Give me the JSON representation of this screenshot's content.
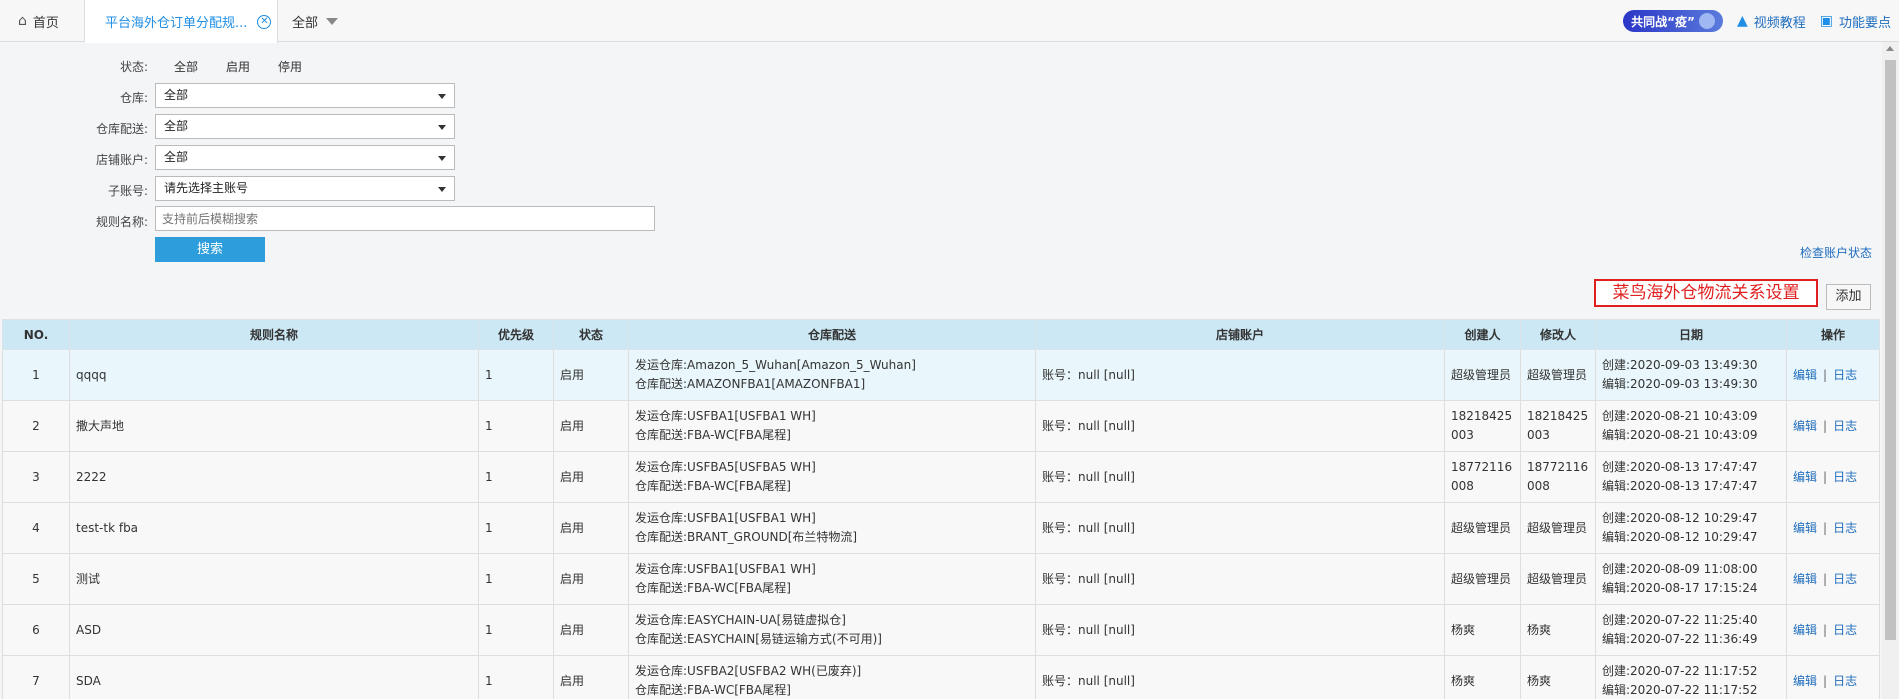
{
  "tabs": {
    "home": "首页",
    "active": "平台海外仓订单分配规...",
    "all": "全部"
  },
  "top_right": {
    "badge": "共同战“疫”",
    "video": "视频教程",
    "features": "功能要点"
  },
  "filters": {
    "status_label": "状态:",
    "status_options": [
      "全部",
      "启用",
      "停用"
    ],
    "warehouse_label": "仓库:",
    "warehouse_value": "全部",
    "delivery_label": "仓库配送:",
    "delivery_value": "全部",
    "shop_label": "店铺账户:",
    "shop_value": "全部",
    "sub_label": "子账号:",
    "sub_value": "请先选择主账号",
    "rule_label": "规则名称:",
    "rule_placeholder": "支持前后模糊搜索",
    "search_button": "搜索",
    "check_link": "检查账户状态"
  },
  "annotation": "菜鸟海外仓物流关系设置",
  "add_button": "添加",
  "table": {
    "headers": [
      "NO.",
      "规则名称",
      "优先级",
      "状态",
      "仓库配送",
      "店铺账户",
      "创建人",
      "修改人",
      "日期",
      "操作"
    ],
    "op_edit": "编辑",
    "op_sep": "|",
    "op_log": "日志",
    "rows": [
      {
        "no": "1",
        "name": "qqqq",
        "priority": "1",
        "status": "启用",
        "wh1": "发运仓库:Amazon_5_Wuhan[Amazon_5_Wuhan]",
        "wh2": "仓库配送:AMAZONFBA1[AMAZONFBA1]",
        "shop": "账号：null [null]",
        "creator": "超级管理员",
        "modifier": "超级管理员",
        "created": "创建:2020-09-03 13:49:30",
        "edited": "编辑:2020-09-03 13:49:30"
      },
      {
        "no": "2",
        "name": "撒大声地",
        "priority": "1",
        "status": "启用",
        "wh1": "发运仓库:USFBA1[USFBA1 WH]",
        "wh2": "仓库配送:FBA-WC[FBA尾程]",
        "shop": "账号：null [null]",
        "creator": "18218425003",
        "modifier": "18218425003",
        "created": "创建:2020-08-21 10:43:09",
        "edited": "编辑:2020-08-21 10:43:09"
      },
      {
        "no": "3",
        "name": "2222",
        "priority": "1",
        "status": "启用",
        "wh1": "发运仓库:USFBA5[USFBA5 WH]",
        "wh2": "仓库配送:FBA-WC[FBA尾程]",
        "shop": "账号：null [null]",
        "creator": "18772116008",
        "modifier": "18772116008",
        "created": "创建:2020-08-13 17:47:47",
        "edited": "编辑:2020-08-13 17:47:47"
      },
      {
        "no": "4",
        "name": "test-tk fba",
        "priority": "1",
        "status": "启用",
        "wh1": "发运仓库:USFBA1[USFBA1 WH]",
        "wh2": "仓库配送:BRANT_GROUND[布兰特物流]",
        "shop": "账号：null [null]",
        "creator": "超级管理员",
        "modifier": "超级管理员",
        "created": "创建:2020-08-12 10:29:47",
        "edited": "编辑:2020-08-12 10:29:47"
      },
      {
        "no": "5",
        "name": "测试",
        "priority": "1",
        "status": "启用",
        "wh1": "发运仓库:USFBA1[USFBA1 WH]",
        "wh2": "仓库配送:FBA-WC[FBA尾程]",
        "shop": "账号：null [null]",
        "creator": "超级管理员",
        "modifier": "超级管理员",
        "created": "创建:2020-08-09 11:08:00",
        "edited": "编辑:2020-08-17 17:15:24"
      },
      {
        "no": "6",
        "name": "ASD",
        "priority": "1",
        "status": "启用",
        "wh1": "发运仓库:EASYCHAIN-UA[易链虚拟仓]",
        "wh2": "仓库配送:EASYCHAIN[易链运输方式(不可用)]",
        "shop": "账号：null [null]",
        "creator": "杨爽",
        "modifier": "杨爽",
        "created": "创建:2020-07-22 11:25:40",
        "edited": "编辑:2020-07-22 11:36:49"
      },
      {
        "no": "7",
        "name": "SDA",
        "priority": "1",
        "status": "启用",
        "wh1": "发运仓库:USFBA2[USFBA2 WH(已废弃)]",
        "wh2": "仓库配送:FBA-WC[FBA尾程]",
        "shop": "账号：null [null]",
        "creator": "杨爽",
        "modifier": "杨爽",
        "created": "创建:2020-07-22 11:17:52",
        "edited": "编辑:2020-07-22 11:17:52"
      }
    ]
  }
}
